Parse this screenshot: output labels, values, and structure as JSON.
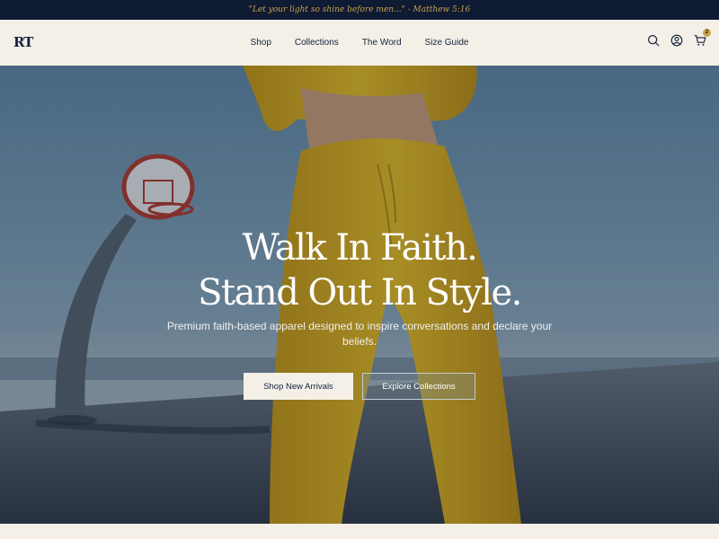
{
  "announcement": {
    "text": "\"Let your light so shine before men...\" - Matthew 5:16"
  },
  "header": {
    "logo": "RT",
    "nav": [
      {
        "label": "Shop"
      },
      {
        "label": "Collections"
      },
      {
        "label": "The Word"
      },
      {
        "label": "Size Guide"
      }
    ],
    "icons": [
      "search-icon",
      "account-icon",
      "cart-icon"
    ],
    "cart_count": "2"
  },
  "hero": {
    "title_line1": "Walk In Faith.",
    "title_line2": "Stand Out In Style.",
    "subtitle": "Premium faith-based apparel designed to inspire conversations and declare your beliefs.",
    "primary_button": "Shop New Arrivals",
    "secondary_button": "Explore Collections"
  },
  "colors": {
    "navy": "#0f1a33",
    "gold": "#c9a24a",
    "cream": "#f4f0e8",
    "outfit_yellow": "#e0b81c"
  }
}
